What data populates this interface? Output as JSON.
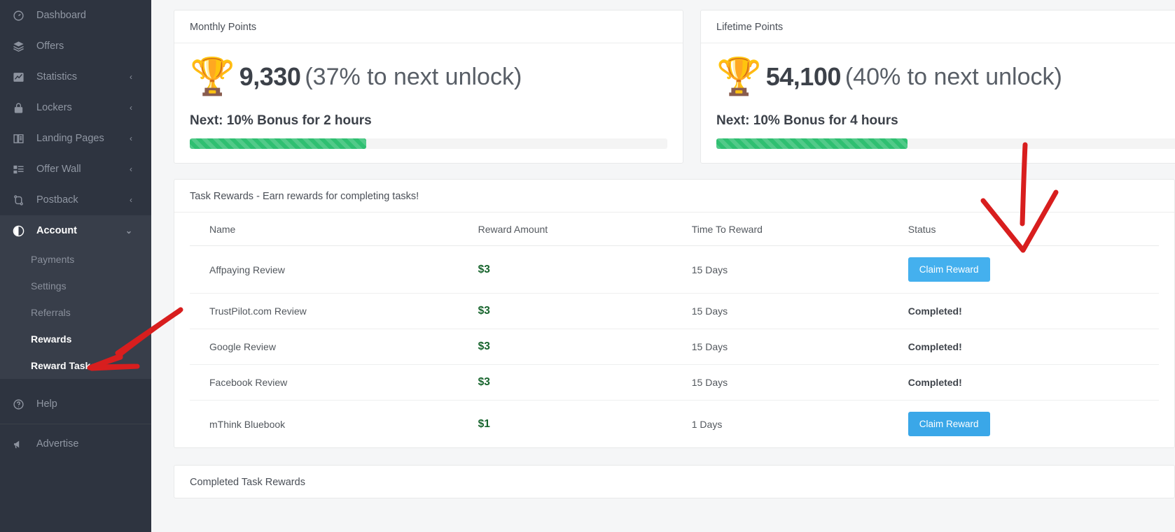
{
  "sidebar": {
    "items": [
      {
        "label": "Dashboard",
        "icon": "dashboard-icon",
        "chevron": "",
        "active": false
      },
      {
        "label": "Offers",
        "icon": "layers-icon",
        "chevron": "",
        "active": false
      },
      {
        "label": "Statistics",
        "icon": "chart-icon",
        "chevron": "‹",
        "active": false
      },
      {
        "label": "Lockers",
        "icon": "lock-icon",
        "chevron": "‹",
        "active": false
      },
      {
        "label": "Landing Pages",
        "icon": "book-icon",
        "chevron": "‹",
        "active": false
      },
      {
        "label": "Offer Wall",
        "icon": "list-icon",
        "chevron": "‹",
        "active": false
      },
      {
        "label": "Postback",
        "icon": "postback-icon",
        "chevron": "‹",
        "active": false
      },
      {
        "label": "Account",
        "icon": "account-icon",
        "chevron": "⌄",
        "active": true
      }
    ],
    "account_children": [
      {
        "label": "Payments",
        "active": false
      },
      {
        "label": "Settings",
        "active": false
      },
      {
        "label": "Referrals",
        "active": false
      },
      {
        "label": "Rewards",
        "active": true
      },
      {
        "label": "Reward Tasks",
        "active": true
      }
    ],
    "footer_items": [
      {
        "label": "Help",
        "icon": "help-icon"
      },
      {
        "label": "Advertise",
        "icon": "megaphone-icon"
      }
    ]
  },
  "monthly_card": {
    "title": "Monthly Points",
    "trophy_icon": "trophy-icon",
    "points": "9,330",
    "unlock_text": "(37% to next unlock)",
    "next_text": "Next: 10% Bonus for 2 hours",
    "progress_percent": 37,
    "progress_color": "#2fbf71"
  },
  "lifetime_card": {
    "title": "Lifetime Points",
    "trophy_icon": "trophy-icon",
    "points": "54,100",
    "unlock_text": "(40% to next unlock)",
    "next_text": "Next: 10% Bonus for 4 hours",
    "progress_percent": 40,
    "progress_color": "#2fbf71"
  },
  "tasks_card": {
    "title": "Task Rewards - Earn rewards for completing tasks!",
    "columns": [
      "Name",
      "Reward Amount",
      "Time To Reward",
      "Status"
    ],
    "rows": [
      {
        "name": "Affpaying Review",
        "amount": "$3",
        "time": "15 Days",
        "status": "Claim Reward",
        "status_type": "button"
      },
      {
        "name": "TrustPilot.com Review",
        "amount": "$3",
        "time": "15 Days",
        "status": "Completed!",
        "status_type": "text"
      },
      {
        "name": "Google Review",
        "amount": "$3",
        "time": "15 Days",
        "status": "Completed!",
        "status_type": "text"
      },
      {
        "name": "Facebook Review",
        "amount": "$3",
        "time": "15 Days",
        "status": "Completed!",
        "status_type": "text"
      },
      {
        "name": "mThink Bluebook",
        "amount": "$1",
        "time": "1 Days",
        "status": "Claim Reward",
        "status_type": "button"
      }
    ]
  },
  "completed_card": {
    "title": "Completed Task Rewards"
  },
  "annotations": {
    "color": "#d81e1e",
    "marks": [
      {
        "name": "arrow-to-reward-tasks",
        "desc": "red hand-drawn arrow pointing left at Rewards / Reward Tasks menu"
      },
      {
        "name": "arrow-to-status-column",
        "desc": "red hand-drawn down arrow pointing at Status column"
      }
    ]
  }
}
